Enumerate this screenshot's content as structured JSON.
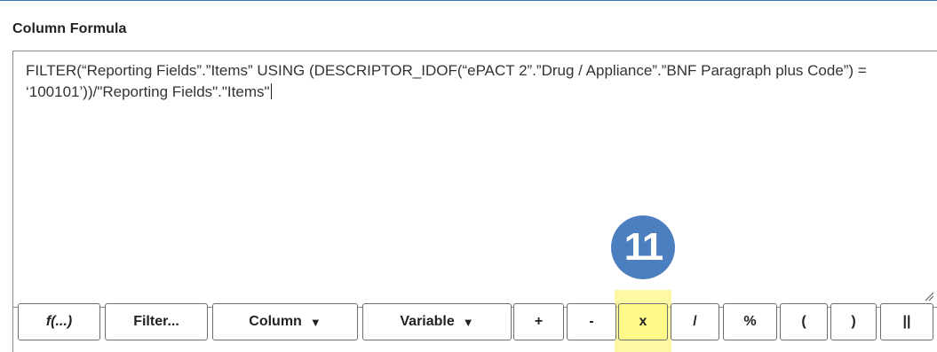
{
  "section": {
    "title": "Column Formula"
  },
  "formula": {
    "text": "FILTER(“Reporting Fields”.”Items” USING (DESCRIPTOR_IDOF(“ePACT 2”.”Drug / Appliance”.”BNF Paragraph plus Code”) = ‘100101’))/\"Reporting Fields\".\"Items\""
  },
  "toolbar": {
    "function_label": "f(...)",
    "filter_label": "Filter...",
    "column_label": "Column",
    "variable_label": "Variable",
    "dropdown_arrow": "▼",
    "plus_label": "+",
    "minus_label": "-",
    "multiply_label": "x",
    "divide_label": "/",
    "percent_label": "%",
    "open_paren_label": "(",
    "close_paren_label": ")",
    "concat_label": "||"
  },
  "annotation": {
    "step_number": "11",
    "highlight_color": "#fbf35a",
    "badge_color": "#4c7fbf"
  }
}
